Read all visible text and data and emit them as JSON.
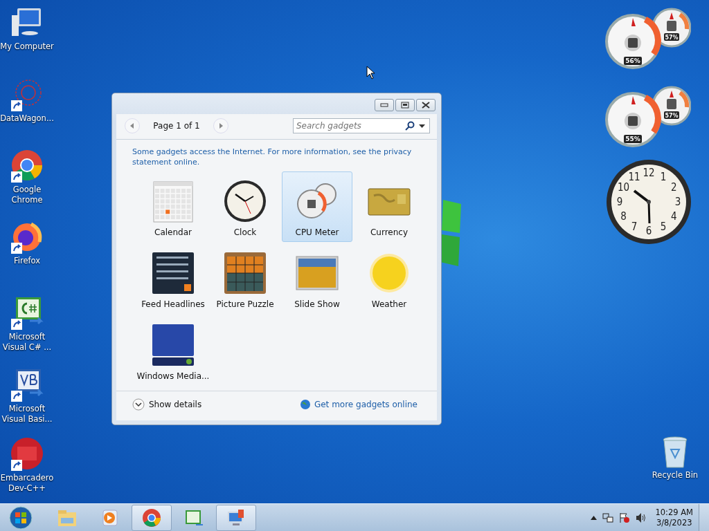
{
  "desktop_icons": [
    {
      "label": "My Computer",
      "kind": "computer"
    },
    {
      "label": "DataWagon...",
      "kind": "datawagon"
    },
    {
      "label": "Google Chrome",
      "kind": "chrome"
    },
    {
      "label": "Firefox",
      "kind": "firefox"
    },
    {
      "label": "Microsoft Visual C# ...",
      "kind": "csharp"
    },
    {
      "label": "Microsoft Visual Basi...",
      "kind": "vb"
    },
    {
      "label": "Embarcadero Dev-C++",
      "kind": "devcpp"
    }
  ],
  "recycle_bin": {
    "label": "Recycle Bin"
  },
  "gadgets_window": {
    "page_label": "Page 1 of 1",
    "search": {
      "placeholder": "Search gadgets"
    },
    "notice": "Some gadgets access the Internet.  For more information, see the privacy statement online.",
    "gadgets": [
      {
        "label": "Calendar",
        "kind": "calendar",
        "selected": false
      },
      {
        "label": "Clock",
        "kind": "clock",
        "selected": false
      },
      {
        "label": "CPU Meter",
        "kind": "cpu",
        "selected": true
      },
      {
        "label": "Currency",
        "kind": "currency",
        "selected": false
      },
      {
        "label": "Feed Headlines",
        "kind": "feed",
        "selected": false
      },
      {
        "label": "Picture Puzzle",
        "kind": "puzzle",
        "selected": false
      },
      {
        "label": "Slide Show",
        "kind": "slideshow",
        "selected": false
      },
      {
        "label": "Weather",
        "kind": "weather",
        "selected": false
      },
      {
        "label": "Windows Media...",
        "kind": "media",
        "selected": false
      }
    ],
    "show_details": "Show details",
    "get_more": "Get more gadgets online"
  },
  "desktop_gadgets": {
    "cpu_meters": [
      {
        "cpu": "56%",
        "memory": "57%"
      },
      {
        "cpu": "55%",
        "memory": "57%"
      }
    ],
    "clock": {
      "numerals": [
        "12",
        "11",
        "1",
        "10",
        "2",
        "9",
        "3",
        "8",
        "4",
        "7",
        "5",
        "6"
      ]
    }
  },
  "taskbar": {
    "buttons": [
      {
        "kind": "explorer",
        "open": false
      },
      {
        "kind": "mediaplayer",
        "open": false
      },
      {
        "kind": "chrome",
        "open": true
      },
      {
        "kind": "csharp",
        "open": false
      },
      {
        "kind": "remote",
        "open": true
      }
    ],
    "time": "10:29 AM",
    "date": "3/8/2023"
  }
}
